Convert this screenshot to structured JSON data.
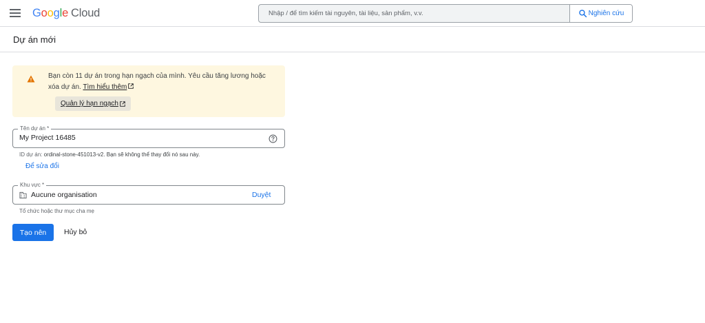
{
  "header": {
    "logo_google": [
      "G",
      "o",
      "o",
      "g",
      "l",
      "e"
    ],
    "logo_cloud": "Cloud",
    "search_placeholder": "Nhập / để tìm kiếm tài nguyên, tài liệu, sản phẩm, v.v.",
    "search_button": "Nghiên cứu"
  },
  "page": {
    "title": "Dự án mới"
  },
  "warning": {
    "text": "Bạn còn 11 dự án trong hạn ngạch của mình. Yêu cầu tăng lương hoặc xóa dự án.",
    "learn_more": "Tìm hiểu thêm",
    "manage_quota": "Quản lý hạn ngạch"
  },
  "form": {
    "project_name_label": "Tên dự án *",
    "project_name_value": "My Project 16485",
    "project_id_prefix": "ID dự án: ",
    "project_id_value": "ordinal-stone-451013-v2. Bạn sẽ không thể thay đổi nó sau này.",
    "edit_link": "Để sửa đổi",
    "region_label": "Khu vực *",
    "region_value": "Aucune organisation",
    "browse": "Duyệt",
    "region_hint": "Tổ chức hoặc thư mục cha mẹ"
  },
  "actions": {
    "create": "Tạo nên",
    "cancel": "Hủy bỏ"
  },
  "colors": {
    "accent": "#1a73e8",
    "warning_bg": "#fef7e0",
    "warning_icon": "#e37400"
  }
}
